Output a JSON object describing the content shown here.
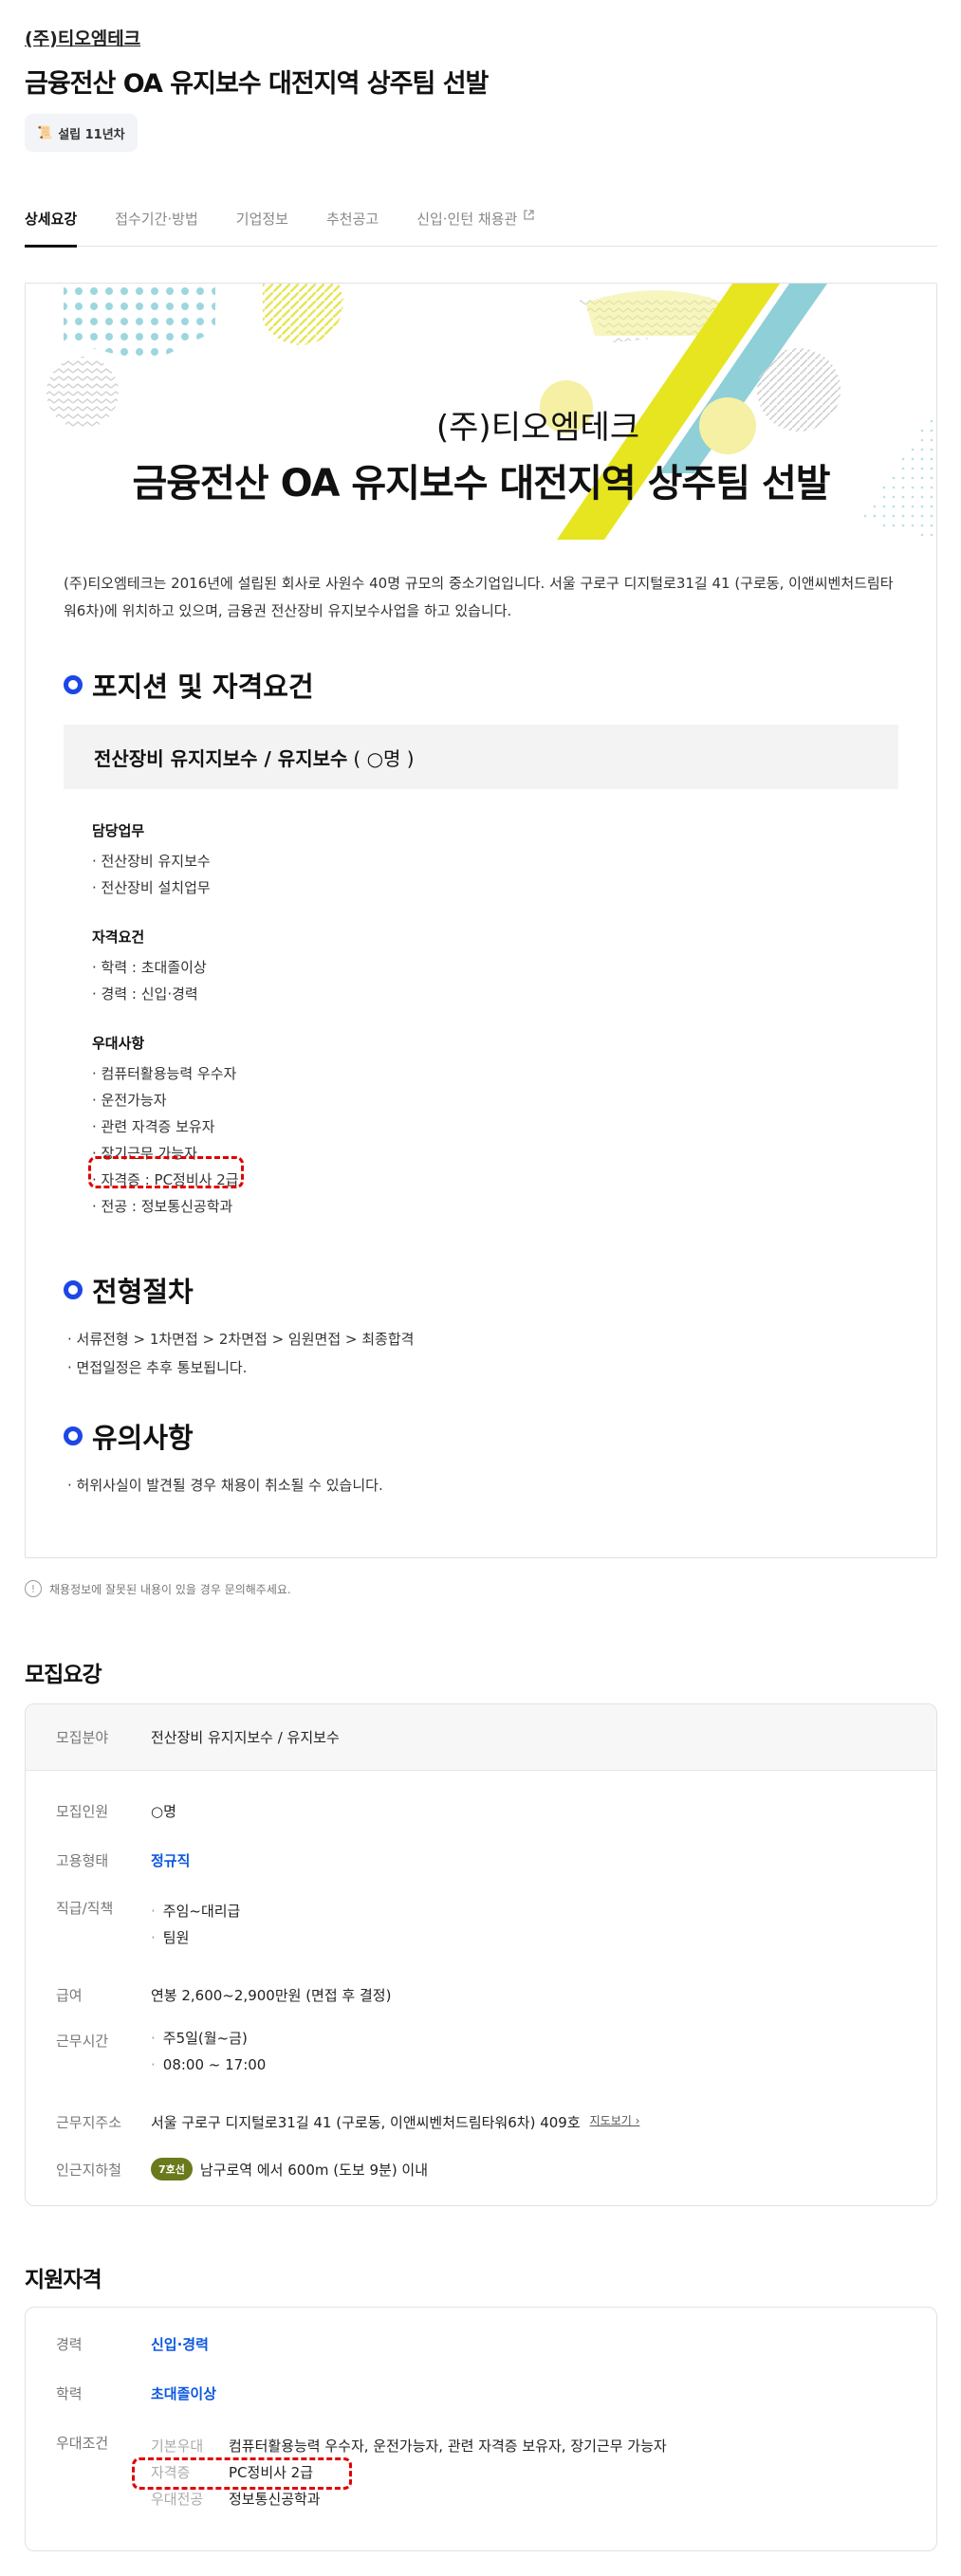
{
  "header": {
    "company": "(주)티오엠테크",
    "title": "금융전산 OA 유지보수 대전지역 상주팀 선발",
    "founded_badge": "설립 11년차"
  },
  "tabs": [
    {
      "label": "상세요강"
    },
    {
      "label": "접수기간·방법"
    },
    {
      "label": "기업정보"
    },
    {
      "label": "추천공고"
    },
    {
      "label": "신입·인턴 채용관"
    }
  ],
  "banner": {
    "company": "(주)티오엠테크",
    "title": "금융전산 OA 유지보수 대전지역 상주팀 선발"
  },
  "intro": "(주)티오엠테크는 2016년에 설립된 회사로 사원수 40명 규모의 중소기업입니다. 서울 구로구 디지털로31길 41 (구로동, 이앤씨벤처드림타워6차)에 위치하고 있으며, 금융권 전산장비 유지보수사업을 하고 있습니다.",
  "position": {
    "heading": "포지션 및 자격요건",
    "name": "전산장비 유지지보수 / 유지보수",
    "count": "( ○명 )",
    "duties_title": "담당업무",
    "duties": [
      "· 전산장비 유지보수",
      "· 전산장비 설치업무"
    ],
    "req_title": "자격요건",
    "reqs": [
      "· 학력 : 초대졸이상",
      "· 경력 : 신입·경력"
    ],
    "pref_title": "우대사항",
    "prefs": [
      "· 컴퓨터활용능력 우수자",
      "· 운전가능자",
      "· 관련 자격증 보유자",
      "· 장기근무 가능자",
      "· 자격증 : PC정비사 2급",
      "· 전공 : 정보통신공학과"
    ]
  },
  "process": {
    "heading": "전형절차",
    "lines": [
      "· 서류전형 > 1차면접 > 2차면접 > 임원면접 > 최종합격",
      "· 면접일정은 추후 통보됩니다."
    ]
  },
  "notes": {
    "heading": "유의사항",
    "lines": [
      "· 허위사실이 발견될 경우 채용이 취소될 수 있습니다."
    ]
  },
  "error_notice": "채용정보에 잘못된 내용이 있을 경우 문의해주세요.",
  "recruit": {
    "heading": "모집요강",
    "field_label": "모집분야",
    "field": "전산장비 유지지보수 / 유지보수",
    "count_label": "모집인원",
    "count": "○명",
    "type_label": "고용형태",
    "type": "정규직",
    "rank_label": "직급/직책",
    "ranks": [
      "주임~대리급",
      "팀원"
    ],
    "salary_label": "급여",
    "salary": "연봉 2,600~2,900만원 (면접 후 결정)",
    "hours_label": "근무시간",
    "hours": [
      "주5일(월~금)",
      "08:00 ~ 17:00"
    ],
    "addr_label": "근무지주소",
    "addr": "서울 구로구 디지털로31길 41 (구로동, 이앤씨벤처드림타워6차) 409호",
    "map_link": "지도보기 ›",
    "subway_label": "인근지하철",
    "subway_line": "7호선",
    "subway": "남구로역 에서 600m (도보 9분) 이내"
  },
  "qual": {
    "heading": "지원자격",
    "career_label": "경력",
    "career": "신입·경력",
    "edu_label": "학력",
    "edu": "초대졸이상",
    "pref_label": "우대조건",
    "basic_label": "기본우대",
    "basic": "컴퓨터활용능력 우수자, 운전가능자, 관련 자격증 보유자, 장기근무 가능자",
    "cert_label": "자격증",
    "cert": "PC정비사 2급",
    "major_label": "우대전공",
    "major": "정보통신공학과"
  },
  "colors": {
    "accent_blue": "#1c47e6",
    "link_blue": "#0a57e0",
    "highlight": "#e00000",
    "subway_badge": "#6a7a1c"
  }
}
